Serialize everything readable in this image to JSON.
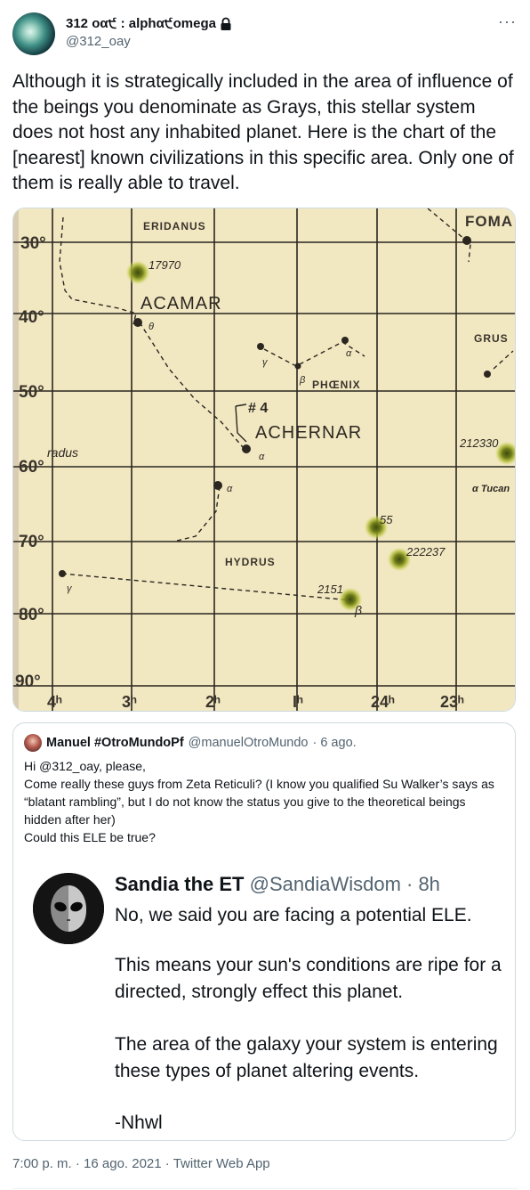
{
  "author": {
    "display_name": "312 οα੯ : alphα੯omega",
    "handle": "@312_oay",
    "verified_icon": "lock-icon"
  },
  "more_label": "···",
  "tweet_text": "Although it is strategically included in the area of influence of the beings you denominate as Grays, this stellar system does not host any inhabited planet. Here is the chart of the [nearest] known civilizations in this specific area. Only one of them is really able to travel.",
  "star_chart": {
    "dec_labels": [
      "30°",
      "40°",
      "50°",
      "60°",
      "70°",
      "80°",
      "90°"
    ],
    "ra_labels": [
      "4ʰ",
      "3ʰ",
      "2ʰ",
      "Iʰ",
      "24ʰ",
      "23ʰ"
    ],
    "constellations": [
      "ERIDANUS",
      "PHŒNIX",
      "HYDRUS",
      "GRUS",
      "FOMA"
    ],
    "stars": [
      "ACAMAR",
      "ACHERNAR"
    ],
    "fragments": [
      "radus",
      "α Tucan"
    ],
    "marker": "# 4",
    "greek": [
      "θ",
      "α",
      "γ",
      "β",
      "α",
      "α",
      "γ",
      "β"
    ],
    "highlight_labels": [
      "17970",
      "55",
      "222237",
      "2151",
      "212330"
    ]
  },
  "quote": {
    "name": "Manuel #OtroMundoPf",
    "handle": "@manuelOtroMundo",
    "time": "· 6 ago.",
    "lines": [
      "Hi @312_oay, please,",
      "Come really these guys from Zeta Reticuli? (I know you qualified Su Walker’s says as “blatant rambling”, but I do not know the status you give to the theoretical beings hidden after her)",
      "Could this ELE be true?"
    ],
    "screenshot": {
      "name": "Sandia the ET",
      "handle": "@SandiaWisdom · 8h",
      "lines": [
        "No, we said you are facing a potential ELE.",
        "This means your sun's conditions are ripe for a",
        "directed, strongly effect this planet.",
        "The area of the galaxy your system is entering",
        "these types of planet altering events.",
        "-Nhwl"
      ]
    }
  },
  "footer": {
    "time": "7:00 p. m. · 16 ago. 2021 · ",
    "app": "Twitter Web App"
  }
}
